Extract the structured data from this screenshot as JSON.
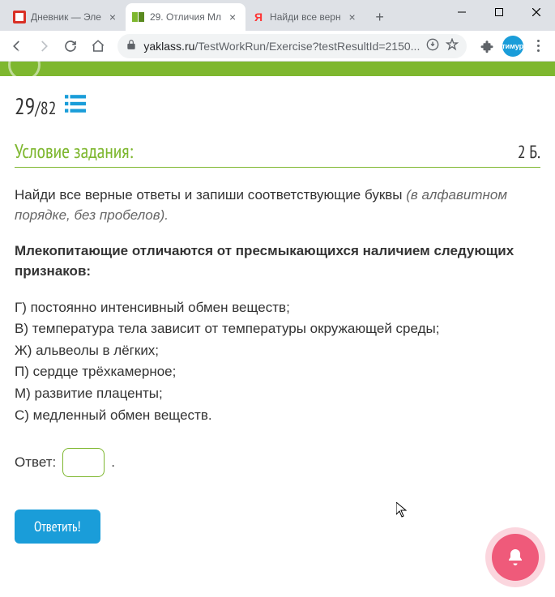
{
  "window": {
    "tabs": [
      {
        "title": "Дневник — Эле",
        "favicon": "docs"
      },
      {
        "title": "29. Отличия Мл",
        "favicon": "yaklass",
        "active": true
      },
      {
        "title": "Найди все верн",
        "favicon": "yandex"
      }
    ]
  },
  "toolbar": {
    "url_domain": "yaklass.ru",
    "url_path": "/TestWorkRun/Exercise?testResultId=2150...",
    "avatar_text": "тимур"
  },
  "page": {
    "progress_current": "29",
    "progress_total": "/82",
    "task_header": "Условие задания:",
    "points": "2 Б.",
    "instruction_main": "Найди все верные ответы и запиши соответствующие буквы ",
    "instruction_hint": "(в алфавитном порядке, без пробелов).",
    "question": "Млекопитающие отличаются от пресмыкающихся наличием следующих признаков:",
    "options": [
      "Г) постоянно интенсивный обмен веществ;",
      "В) температура тела зависит от температуры окружающей среды;",
      "Ж) альвеолы в лёгких;",
      "П) сердце трёхкамерное;",
      "М) развитие плаценты;",
      "С) медленный обмен веществ."
    ],
    "answer_label": "Ответ:",
    "answer_suffix": ".",
    "submit_label": "Ответить!"
  }
}
